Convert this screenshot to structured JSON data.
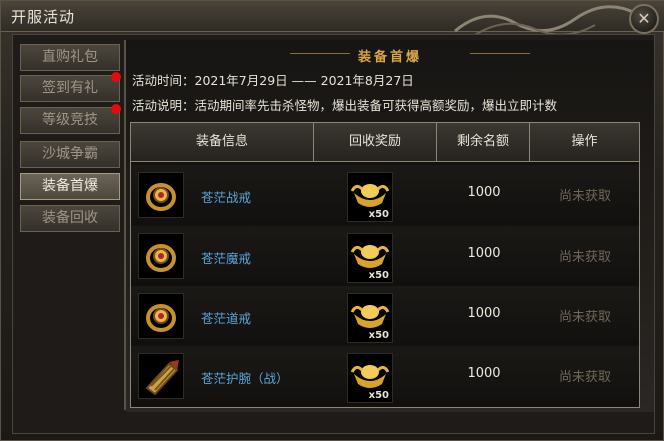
{
  "window": {
    "title": "开服活动"
  },
  "sidebar": {
    "items": [
      {
        "label": "直购礼包",
        "badge": false,
        "active": false
      },
      {
        "label": "签到有礼",
        "badge": true,
        "active": false
      },
      {
        "label": "等级竞技",
        "badge": true,
        "active": false
      },
      {
        "label": "沙城争霸",
        "badge": false,
        "active": false
      },
      {
        "label": "装备首爆",
        "badge": false,
        "active": true
      },
      {
        "label": "装备回收",
        "badge": false,
        "active": false
      }
    ]
  },
  "main": {
    "section_title": "装备首爆",
    "time_line": "活动时间：2021年7月29日 —— 2021年8月27日",
    "desc_line": "活动说明：活动期间率先击杀怪物，爆出装备可获得高额奖励，爆出立即计数",
    "table": {
      "headers": [
        "装备信息",
        "回收奖励",
        "剩余名额",
        "操作"
      ],
      "rows": [
        {
          "name": "苍茫战戒",
          "icon": "ring-icon",
          "reward_qty": "x50",
          "remain": "1000",
          "action": "尚未获取"
        },
        {
          "name": "苍茫魔戒",
          "icon": "ring-icon",
          "reward_qty": "x50",
          "remain": "1000",
          "action": "尚未获取"
        },
        {
          "name": "苍茫道戒",
          "icon": "ring-icon",
          "reward_qty": "x50",
          "remain": "1000",
          "action": "尚未获取"
        },
        {
          "name": "苍茫护腕（战）",
          "icon": "bracer-icon",
          "reward_qty": "x50",
          "remain": "1000",
          "action": "尚未获取"
        }
      ]
    }
  },
  "colors": {
    "accent_gold": "#d8a54b",
    "item_blue": "#5aa6d6",
    "badge_red": "#e30c0c"
  }
}
